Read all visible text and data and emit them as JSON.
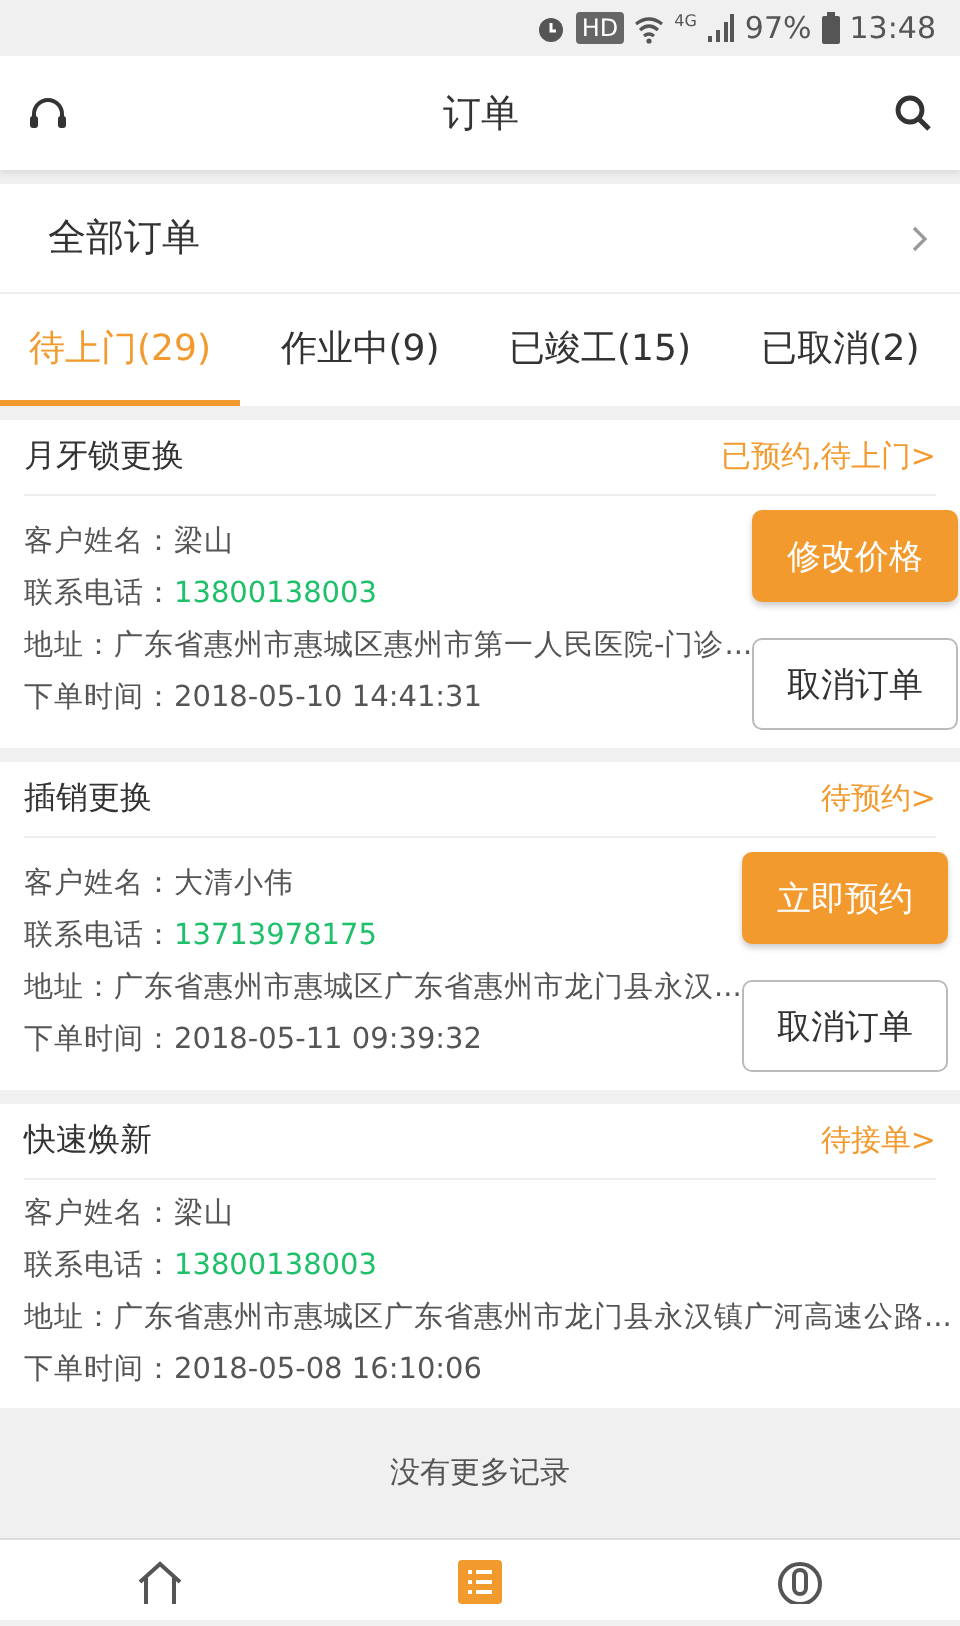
{
  "status_bar": {
    "hd": "HD",
    "network": "4G",
    "battery": "97%",
    "time": "13:48"
  },
  "header": {
    "title": "订单"
  },
  "all_orders": {
    "label": "全部订单"
  },
  "tabs": [
    {
      "label": "待上门(29)",
      "selected": true
    },
    {
      "label": "作业中(9)",
      "selected": false
    },
    {
      "label": "已竣工(15)",
      "selected": false
    },
    {
      "label": "已取消(2)",
      "selected": false
    }
  ],
  "orders": [
    {
      "title": "月牙锁更换",
      "status": "已预约,待上门>",
      "fields": [
        {
          "kind": "text",
          "label": "客户姓名：",
          "value": "梁山"
        },
        {
          "kind": "phone",
          "label": "联系电话：",
          "value": "13800138003"
        },
        {
          "kind": "text",
          "label": "地址：",
          "value": "广东省惠州市惠城区惠州市第一人民医院-门诊..."
        },
        {
          "kind": "text",
          "label": "下单时间：",
          "value": "2018-05-10 14:41:31"
        }
      ],
      "buttons": [
        {
          "kind": "primary",
          "label": "修改价格"
        },
        {
          "kind": "outline",
          "label": "取消订单"
        }
      ]
    },
    {
      "title": "插销更换",
      "status": "待预约>",
      "fields": [
        {
          "kind": "text",
          "label": "客户姓名：",
          "value": "大清小伟"
        },
        {
          "kind": "phone",
          "label": "联系电话：",
          "value": "13713978175"
        },
        {
          "kind": "text",
          "label": "地址：",
          "value": "广东省惠州市惠城区广东省惠州市龙门县永汉..."
        },
        {
          "kind": "text",
          "label": "下单时间：",
          "value": "2018-05-11 09:39:32"
        }
      ],
      "buttons": [
        {
          "kind": "primary",
          "label": "立即预约"
        },
        {
          "kind": "outline",
          "label": "取消订单"
        }
      ]
    },
    {
      "title": "快速焕新",
      "status": "待接单>",
      "fields": [
        {
          "kind": "text",
          "label": "客户姓名：",
          "value": "梁山"
        },
        {
          "kind": "phone",
          "label": "联系电话：",
          "value": "13800138003"
        },
        {
          "kind": "text",
          "label": "地址：",
          "value": "广东省惠州市惠城区广东省惠州市龙门县永汉镇广河高速公路..."
        },
        {
          "kind": "text",
          "label": "下单时间：",
          "value": "2018-05-08 16:10:06"
        }
      ]
    }
  ],
  "footer": {
    "text": "没有更多记录"
  },
  "bottom_nav": [
    {
      "kind": "home",
      "selected": false
    },
    {
      "kind": "orders",
      "selected": true
    },
    {
      "kind": "profile",
      "selected": false
    }
  ]
}
